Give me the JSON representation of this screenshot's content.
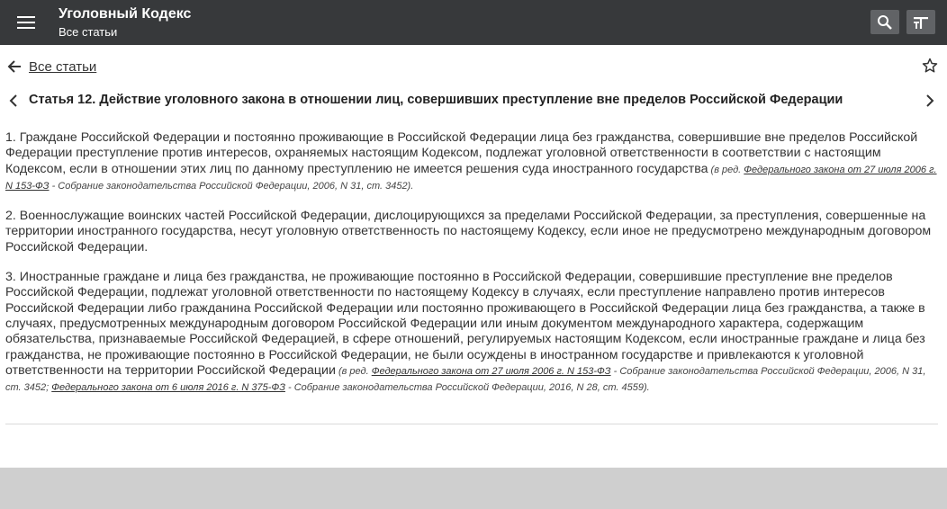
{
  "appbar": {
    "title": "Уголовный Кодекс",
    "subtitle": "Все статьи",
    "icons": [
      "menu-icon",
      "search-icon",
      "font-size-icon"
    ]
  },
  "nav": {
    "back_label": "Все статьи"
  },
  "article": {
    "title": "Статья 12. Действие уголовного закона в отношении лиц, совершивших преступление вне пределов Российской Федерации",
    "p1": {
      "text": "1. Граждане Российской Федерации и постоянно проживающие в Российской Федерации лица без гражданства, совершившие вне пределов Российской Федерации преступление против интересов, охраняемых настоящим Кодексом, подлежат уголовной ответственности в соответствии с настоящим Кодексом, если в отношении этих лиц по данному преступлению не имеется решения суда иностранного государства",
      "note_prefix": " (в ред. ",
      "link1": "Федерального закона от 27 июля 2006 г. N 153-ФЗ",
      "note_suffix": " - Собрание законодательства Российской Федерации, 2006, N 31, ст. 3452)."
    },
    "p2": {
      "text": "2. Военнослужащие воинских частей Российской Федерации, дислоцирующихся за пределами Российской Федерации, за преступления, совершенные на территории иностранного государства, несут уголовную ответственность по настоящему Кодексу, если иное не предусмотрено международным договором Российской Федерации."
    },
    "p3": {
      "text": "3. Иностранные граждане и лица без гражданства, не проживающие постоянно в Российской Федерации, совершившие преступление вне пределов Российской Федерации, подлежат уголовной ответственности по настоящему Кодексу в случаях, если преступление направлено против интересов Российской Федерации либо гражданина Российской Федерации или постоянно проживающего в Российской Федерации лица без гражданства, а также в случаях, предусмотренных международным договором Российской Федерации или иным документом международного характера, содержащим обязательства, признаваемые Российской Федерацией, в сфере отношений, регулируемых настоящим Кодексом, если иностранные граждане и лица без гражданства, не проживающие постоянно в Российской Федерации, не были осуждены в иностранном государстве и привлекаются к уголовной ответственности на территории Российской Федерации",
      "note_prefix": " (в ред. ",
      "link1": "Федерального закона от 27 июля 2006 г. N 153-ФЗ",
      "note_mid": " - Собрание законодательства Российской Федерации, 2006, N 31, ст. 3452; ",
      "link2": "Федерального закона от 6 июля 2016 г. N 375-ФЗ",
      "note_suffix": " - Собрание законодательства Российской Федерации, 2016, N 28, ст. 4559)."
    }
  }
}
